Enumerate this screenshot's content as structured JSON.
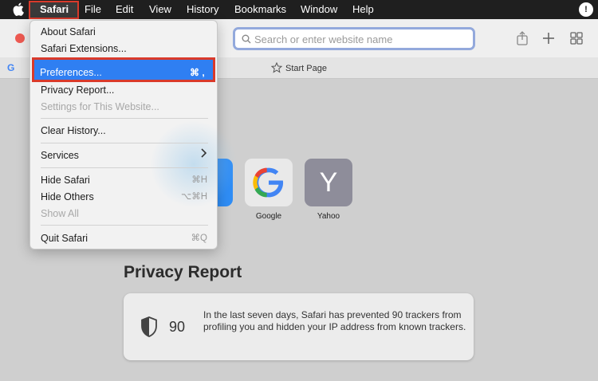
{
  "menubar": {
    "items": [
      "Safari",
      "File",
      "Edit",
      "View",
      "History",
      "Bookmarks",
      "Window",
      "Help"
    ],
    "right_icon": "!"
  },
  "toolbar": {
    "search_placeholder": "Search or enter website name"
  },
  "favbar": {
    "start_page": "Start Page"
  },
  "menu": {
    "about": "About Safari",
    "extensions": "Safari Extensions...",
    "preferences": "Preferences...",
    "preferences_shortcut": "⌘ ,",
    "privacy_report": "Privacy Report...",
    "settings_site": "Settings for This Website...",
    "clear_history": "Clear History...",
    "services": "Services",
    "hide_safari": "Hide Safari",
    "hide_safari_shortcut": "⌘H",
    "hide_others": "Hide Others",
    "hide_others_shortcut": "⌥⌘H",
    "show_all": "Show All",
    "quit": "Quit Safari",
    "quit_shortcut": "⌘Q"
  },
  "favorites": [
    {
      "label": "Google",
      "glyph": "G"
    },
    {
      "label": "Yahoo",
      "glyph": "Y"
    }
  ],
  "privacy": {
    "title": "Privacy Report",
    "count": "90",
    "text": "In the last seven days, Safari has prevented 90 trackers from profiling you and hidden your IP address from known trackers."
  },
  "colors": {
    "highlight": "#2f7ff2",
    "annotation_red": "#d93a2b",
    "google_blue": "#4285f4"
  }
}
